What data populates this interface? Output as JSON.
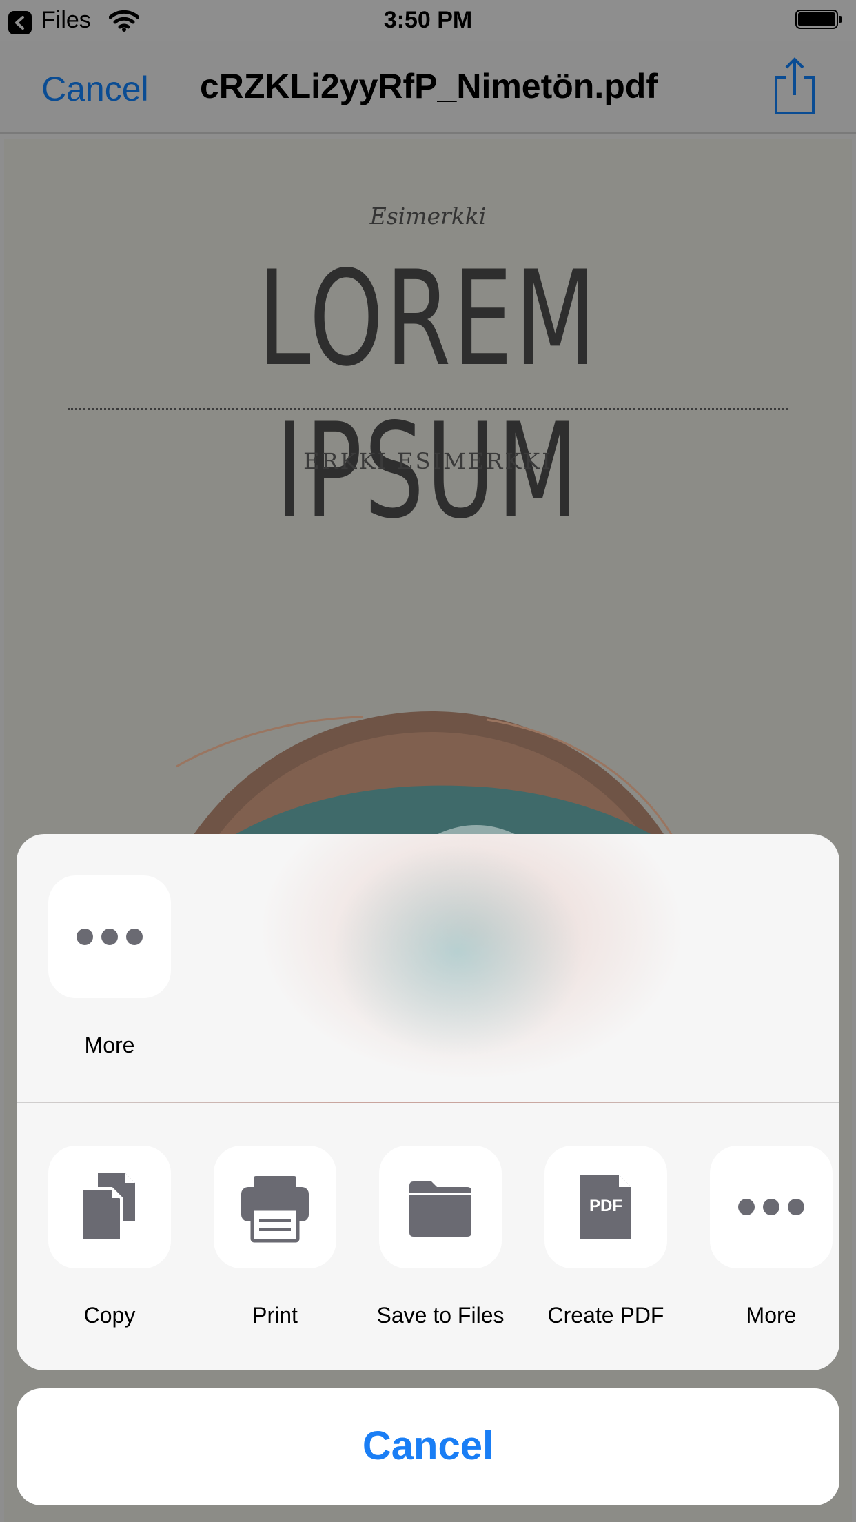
{
  "status_bar": {
    "back_app": "Files",
    "time": "3:50 PM"
  },
  "nav": {
    "cancel_label": "Cancel",
    "title": "cRZKLi2yyRfP_Nimetön.pdf"
  },
  "document": {
    "eyebrow": "Esimerkki",
    "title": "LOREM IPSUM",
    "author": "ERKKI ESIMERKKI"
  },
  "share_sheet": {
    "top_row": [
      {
        "label": "More",
        "icon": "more-icon"
      }
    ],
    "actions": [
      {
        "label": "Copy",
        "icon": "copy-icon"
      },
      {
        "label": "Print",
        "icon": "printer-icon"
      },
      {
        "label": "Save to Files",
        "icon": "folder-icon"
      },
      {
        "label": "Create PDF",
        "icon": "pdf-icon",
        "badge": "PDF"
      },
      {
        "label": "More",
        "icon": "more-icon"
      }
    ],
    "cancel_label": "Cancel"
  },
  "colors": {
    "accent": "#1a7ef5",
    "nav_accent_dimmed": "#0a4c93",
    "icon_gray": "#6a6a72"
  }
}
